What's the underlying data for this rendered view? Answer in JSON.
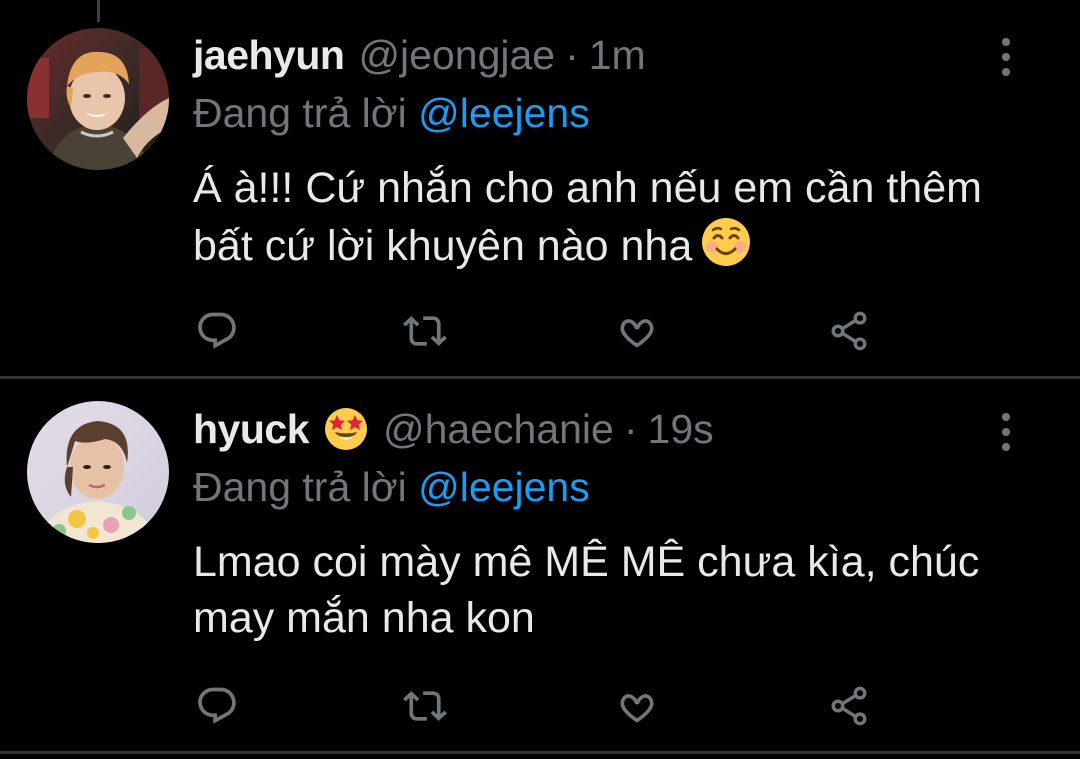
{
  "colors": {
    "background": "#000000",
    "primary_text": "#e7e9ea",
    "secondary_text": "#71767b",
    "link": "#1d9bf0",
    "divider": "#2f3336"
  },
  "tweets": [
    {
      "display_name": "jaehyun",
      "name_emoji": "",
      "handle": "@jeongjae",
      "separator": "·",
      "time": "1m",
      "reply_prefix": "Đang trả lời",
      "reply_to": "@leejens",
      "text": "Á à!!! Cứ nhắn cho anh nếu em cần thêm bất cứ lời khuyên nào nha",
      "text_emoji": "smiling-face-emoji",
      "avatar": "avatar-photo",
      "actions": [
        "reply-icon",
        "retweet-icon",
        "like-icon",
        "share-icon"
      ]
    },
    {
      "display_name": "hyuck",
      "name_emoji": "star-struck-emoji",
      "handle": "@haechanie",
      "separator": "·",
      "time": "19s",
      "reply_prefix": "Đang trả lời",
      "reply_to": "@leejens",
      "text": "Lmao coi mày mê MÊ MÊ chưa kìa, chúc may mắn nha kon",
      "text_emoji": "",
      "avatar": "avatar-photo",
      "actions": [
        "reply-icon",
        "retweet-icon",
        "like-icon",
        "share-icon"
      ]
    }
  ]
}
